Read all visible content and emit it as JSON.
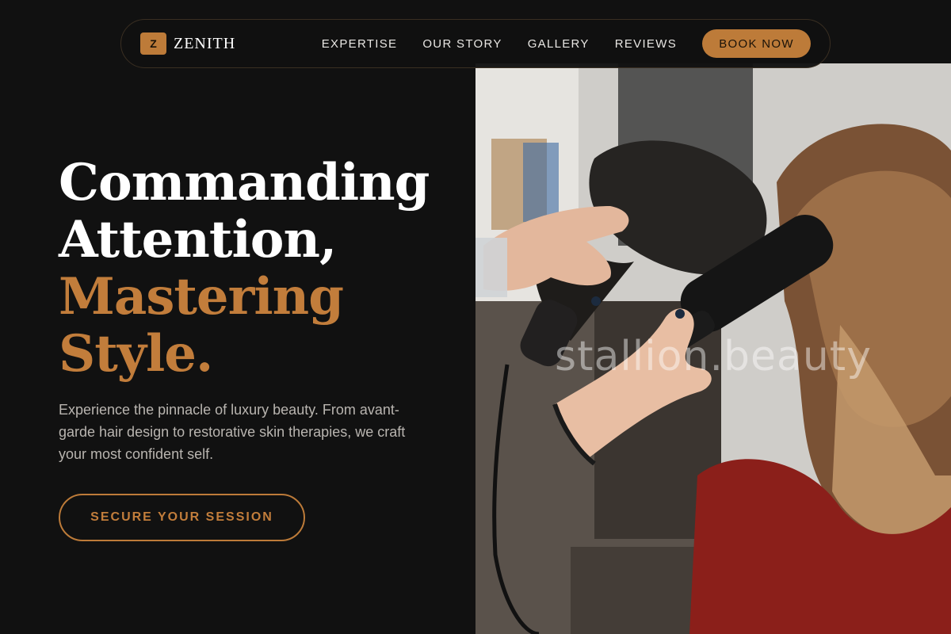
{
  "brand": {
    "mark": "Z",
    "name": "ZENITH"
  },
  "nav": {
    "links": [
      "EXPERTISE",
      "OUR STORY",
      "GALLERY",
      "REVIEWS"
    ],
    "cta_label": "BOOK NOW"
  },
  "hero": {
    "headline_line1": "Commanding",
    "headline_line2": "Attention,",
    "headline_line3": "Mastering",
    "headline_line4": "Style.",
    "lede": "Experience the pinnacle of luxury beauty. From avant-garde hair design to restorative skin therapies, we craft your most confident self.",
    "cta_label": "SECURE YOUR SESSION"
  },
  "photo": {
    "watermark": "stallion.beauty"
  },
  "colors": {
    "background": "#111111",
    "accent": "#bd7b39",
    "text_primary": "#ffffff",
    "text_muted": "#b9b5b0"
  }
}
